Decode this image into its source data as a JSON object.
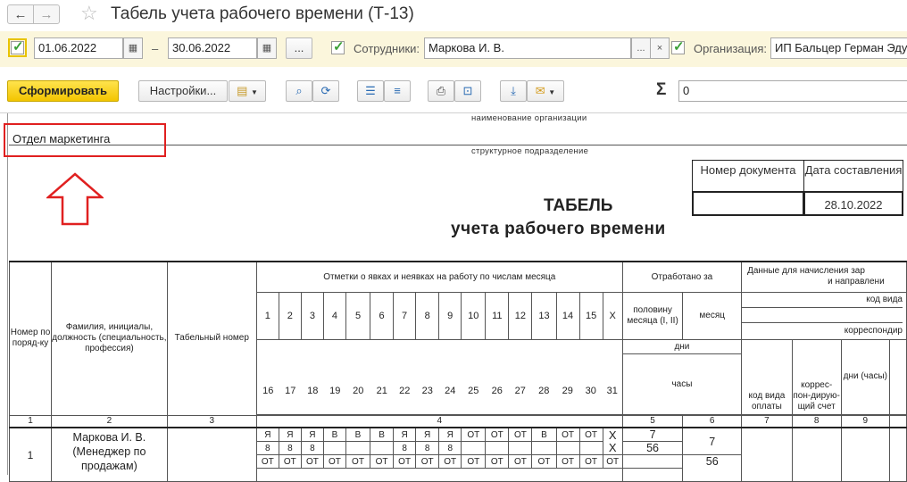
{
  "window": {
    "title": "Табель учета рабочего времени (Т-13)"
  },
  "nav": {
    "back": "←",
    "forward": "→",
    "favorite": "☆"
  },
  "filters": {
    "period_from": "01.06.2022",
    "period_dash": "–",
    "period_to": "30.06.2022",
    "period_more": "...",
    "employees_label": "Сотрудники:",
    "employees_value": "Маркова И. В.",
    "employees_more": "...",
    "employees_clear": "×",
    "org_label": "Организация:",
    "org_value": "ИП Бальцер Герман Эду"
  },
  "toolbar": {
    "generate": "Сформировать",
    "settings": "Настройки...",
    "sigma": "Σ",
    "sum_value": "0"
  },
  "report": {
    "org_caption": "наименование организации",
    "department": "Отдел маркетинга",
    "department_caption": "структурное подразделение",
    "doc_number_header": "Номер документа",
    "doc_date_header": "Дата составления",
    "doc_number": "",
    "doc_date": "28.10.2022",
    "title_main": "ТАБЕЛЬ",
    "title_sub": "учета рабочего времени"
  },
  "table": {
    "col_num": "Номер по поряд-ку",
    "col_name": "Фамилия, инициалы, должность (специальность, профессия)",
    "col_tab": "Табельный номер",
    "marks_header": "Отметки о явках и неявках на работу по числам месяца",
    "days_first": [
      "1",
      "2",
      "3",
      "4",
      "5",
      "6",
      "7",
      "8",
      "9",
      "10",
      "11",
      "12",
      "13",
      "14",
      "15",
      "X"
    ],
    "days_second": [
      "16",
      "17",
      "18",
      "19",
      "20",
      "21",
      "22",
      "23",
      "24",
      "25",
      "26",
      "27",
      "28",
      "29",
      "30",
      "31"
    ],
    "worked_header": "Отработано за",
    "half_month": "половину месяца (I, II)",
    "month": "месяц",
    "days_label": "дни",
    "hours_label": "часы",
    "payroll_header": "Данные для начисления зар",
    "payroll_header2": "и направлени",
    "pay_code_label": "код вида",
    "corr_label": "корреспондир",
    "pay_code": "код вида оплаты",
    "corr_account": "коррес-пон-дирую-щий счет",
    "days_hours": "дни (часы)",
    "col_numbers": [
      "1",
      "2",
      "3",
      "4",
      "5",
      "6",
      "7",
      "8",
      "9"
    ],
    "employee": {
      "num": "1",
      "name": "Маркова И. В. (Менеджер по продажам)",
      "tab_number": "",
      "row1_codes": [
        "Я",
        "Я",
        "Я",
        "В",
        "В",
        "В",
        "Я",
        "Я",
        "Я",
        "ОТ",
        "ОТ",
        "ОТ",
        "В",
        "ОТ",
        "ОТ",
        "X"
      ],
      "row1_hours": [
        "8",
        "8",
        "8",
        "",
        "",
        "",
        "8",
        "8",
        "8",
        "",
        "",
        "",
        "",
        "",
        "",
        "X"
      ],
      "row2_codes": [
        "ОТ",
        "ОТ",
        "ОТ",
        "ОТ",
        "ОТ",
        "ОТ",
        "ОТ",
        "ОТ",
        "ОТ",
        "ОТ",
        "ОТ",
        "ОТ",
        "ОТ",
        "ОТ",
        "ОТ",
        "ОТ"
      ],
      "half_days": "7",
      "half_hours": "56",
      "month_days": "7",
      "month_hours": "56"
    }
  },
  "colors": {
    "filter_bg": "#fbf6dc",
    "primary_button": "#f3c500",
    "highlight_red": "#e02020",
    "check_green": "#3aa035"
  }
}
